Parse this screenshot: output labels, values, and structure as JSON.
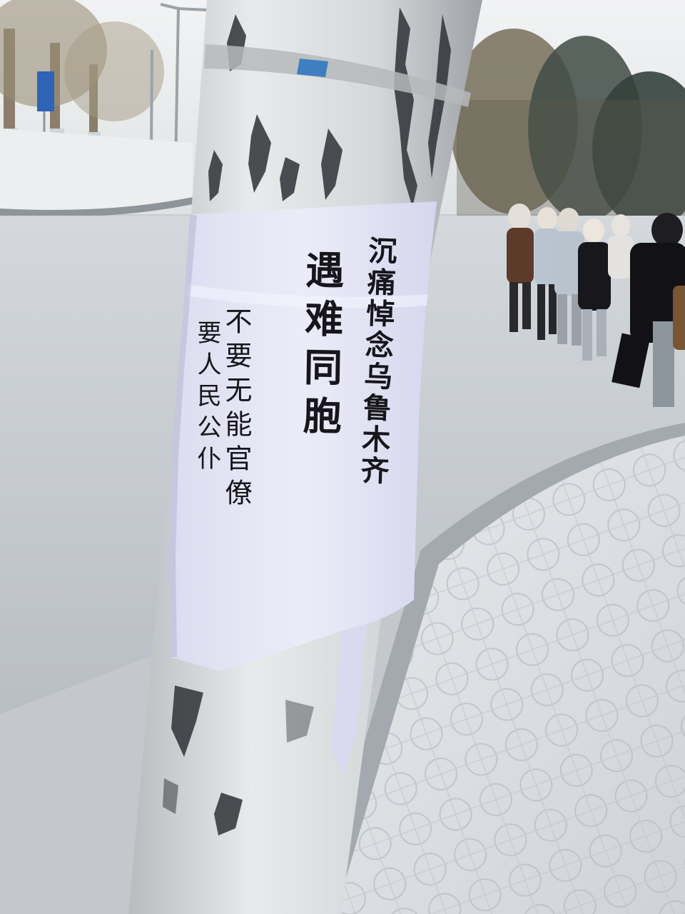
{
  "poster": {
    "lines": [
      "沉痛悼念乌鲁木齐",
      "遇难同胞",
      "不要无能官僚",
      "要人民公仆"
    ]
  },
  "colors": {
    "snow": "#e9ebee",
    "pole": "#d9dcdf",
    "paper": "#e6e6f5",
    "sky": "#eef0f2",
    "ink": "#16161c"
  }
}
